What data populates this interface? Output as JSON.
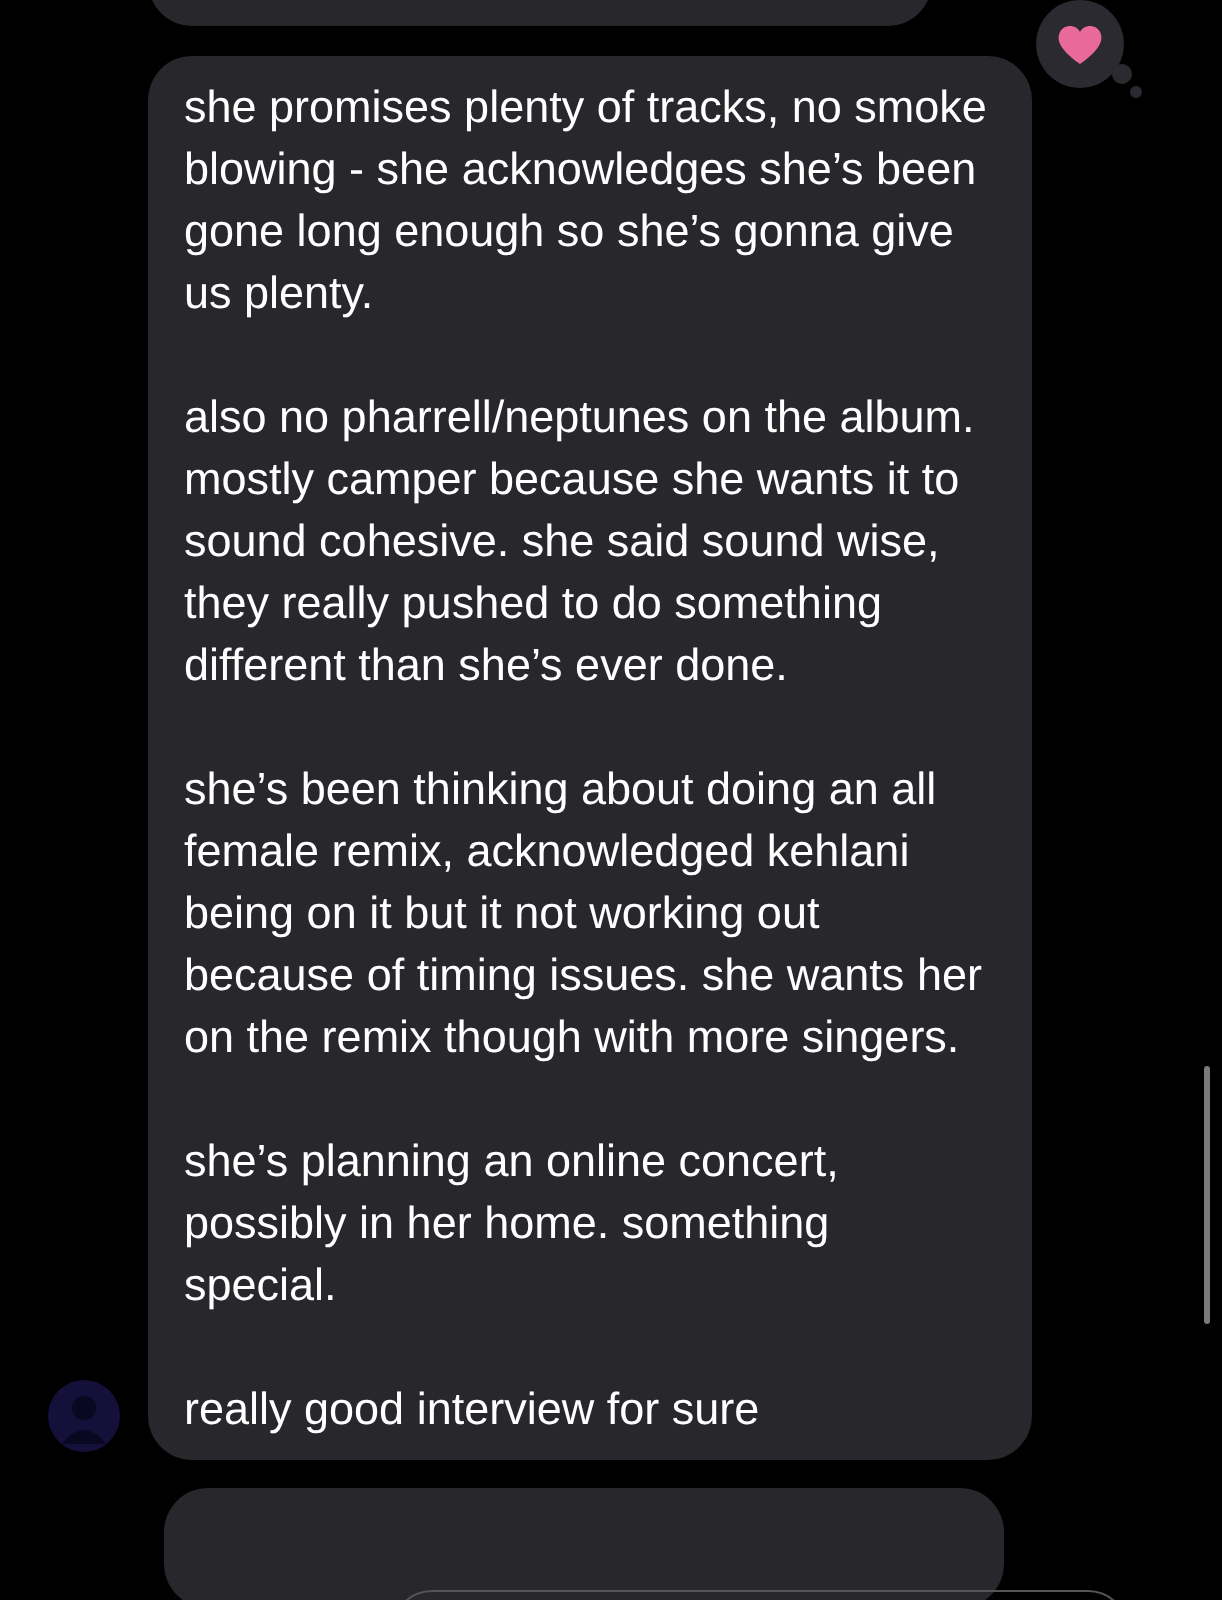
{
  "messages": [
    {
      "kind": "partial"
    },
    {
      "kind": "text",
      "hearted": true,
      "paragraphs": [
        "she promises plenty of tracks, no smoke blowing - she acknowledges she’s been gone long enough so she’s gonna give us plenty.",
        "also no pharrell/neptunes on the album. mostly camper because she wants it to sound cohesive. she said sound wise, they really pushed to do something different than she’s ever done.",
        "she’s been thinking about doing an all female remix, acknowledged kehlani being on it but it not working out because of timing issues. she wants her on the remix though with more singers.",
        "she’s planning an online concert, possibly in her home. something special.",
        "really good interview for sure"
      ]
    },
    {
      "kind": "partial"
    }
  ]
}
